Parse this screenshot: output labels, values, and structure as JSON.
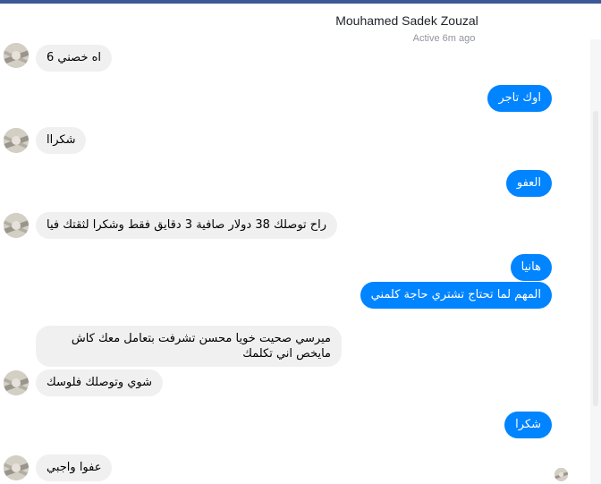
{
  "header": {
    "name": "Mouhamed Sadek Zouzal",
    "status": "Active 6m ago"
  },
  "colors": {
    "outgoing": "#0084ff",
    "incoming": "#f1f0f0",
    "topbar": "#3b5998"
  },
  "messages": [
    {
      "from": "them",
      "text": "اه خصني 6"
    },
    {
      "from": "me",
      "text": "اوك تاجر"
    },
    {
      "from": "them",
      "text": "شكراا"
    },
    {
      "from": "me",
      "text": "العفو"
    },
    {
      "from": "them",
      "text": "راح توصلك 38 دولار صافية 3 دقايق فقط وشكرا لثقتك فيا"
    },
    {
      "from": "me",
      "text": "هانيا"
    },
    {
      "from": "me",
      "text": "المهم لما تحتاج تشتري حاجة كلمني"
    },
    {
      "from": "them",
      "text": "ميرسي صحيت خويا محسن تشرفت بتعامل معك كاش مايخص اني تكلمك"
    },
    {
      "from": "them",
      "text": "شوي وتوصلك فلوسك"
    },
    {
      "from": "me",
      "text": "شكرا"
    },
    {
      "from": "them",
      "text": "عفوا واجبي"
    }
  ]
}
